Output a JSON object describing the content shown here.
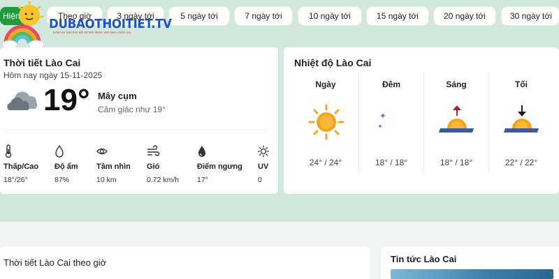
{
  "nav": {
    "active_label": "Hiện",
    "tabs": [
      "Theo giờ",
      "3 ngày tới",
      "5 ngày tới",
      "7 ngày tới",
      "10 ngày tới",
      "15 ngày tới",
      "20 ngày tới",
      "30 ngày tới"
    ]
  },
  "logo": {
    "text": "DUBAOTHOITIET.TV",
    "tagline": "Kênh dự báo thời tiết 63 tỉnh thành Việt Nam chính xác"
  },
  "current": {
    "title": "Thời tiết Lào Cai",
    "date": "Hôm nay ngày 15-11-2025",
    "temp": "19°",
    "condition": "Mây cụm",
    "feels_like": "Cảm giác như 19°",
    "icon": "cloud-icon",
    "stats": [
      {
        "label": "Thấp/Cao",
        "value": "18°/26°",
        "icon": "thermometer-icon"
      },
      {
        "label": "Độ ẩm",
        "value": "87%",
        "icon": "droplet-icon"
      },
      {
        "label": "Tầm nhìn",
        "value": "10 km",
        "icon": "eye-icon"
      },
      {
        "label": "Gió",
        "value": "0.72 km/h",
        "icon": "wind-icon"
      },
      {
        "label": "Điểm ngưng",
        "value": "17°",
        "icon": "dew-drop-icon"
      },
      {
        "label": "UV",
        "value": "0",
        "icon": "sun-uv-icon"
      }
    ]
  },
  "temperature": {
    "title": "Nhiệt độ Lào Cai",
    "periods": [
      {
        "label": "Ngày",
        "value": "24° / 24°",
        "icon": "sun-icon"
      },
      {
        "label": "Đêm",
        "value": "18° / 18°",
        "icon": "moon-stars-icon"
      },
      {
        "label": "Sáng",
        "value": "18° / 18°",
        "icon": "sunrise-icon"
      },
      {
        "label": "Tối",
        "value": "22° / 22°",
        "icon": "sunset-icon"
      }
    ]
  },
  "hourly": {
    "title": "Thời tiết Lào Cai theo giờ"
  },
  "news": {
    "title": "Tin tức Lào Cai"
  },
  "colors": {
    "accent": "#1f9a3e",
    "background": "#d2e8dc",
    "logo_blue": "#1b55c4",
    "sun": "#f6a623"
  }
}
